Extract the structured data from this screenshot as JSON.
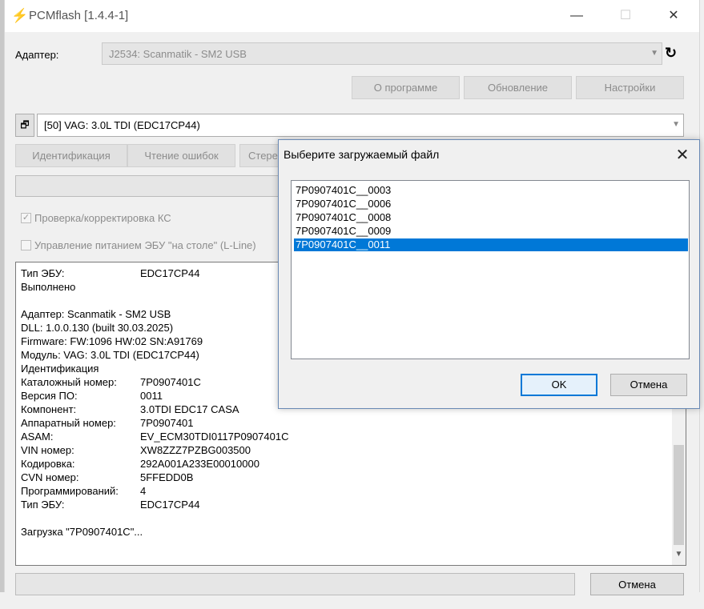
{
  "window": {
    "title": "PCMflash [1.4.4-1]",
    "controls": {
      "minimize": "—",
      "maximize": "☐",
      "close": "✕"
    }
  },
  "adapter": {
    "label": "Адаптер:",
    "value": "J2534: Scanmatik - SM2 USB"
  },
  "top_buttons": {
    "about": "О программе",
    "update": "Обновление",
    "settings": "Настройки"
  },
  "module": {
    "value": "[50] VAG: 3.0L TDI (EDC17CP44)"
  },
  "action_buttons": {
    "identification": "Идентификация",
    "read_errors": "Чтение ошибок",
    "erase_partial": "Стере"
  },
  "options": {
    "checksum": {
      "label": "Проверка/корректировка КС",
      "checked": true
    },
    "power": {
      "label": "Управление питанием ЭБУ \"на столе\" (L-Line)",
      "checked": false
    }
  },
  "log": {
    "head": [
      {
        "key": "Тип ЭБУ:",
        "value": "EDC17CP44"
      },
      {
        "key": "Выполнено",
        "value": ""
      }
    ],
    "info": [
      "Адаптер: Scanmatik - SM2 USB",
      "DLL: 1.0.0.130 (built 30.03.2025)",
      "Firmware: FW:1096 HW:02 SN:A91769",
      "Модуль: VAG: 3.0L TDI (EDC17CP44)",
      "Идентификация"
    ],
    "fields": [
      {
        "key": "Каталожный номер:",
        "value": "7P0907401C"
      },
      {
        "key": "Версия ПО:",
        "value": "0011"
      },
      {
        "key": "Компонент:",
        "value": "3.0TDI EDC17 CASA"
      },
      {
        "key": "Аппаратный номер:",
        "value": "7P0907401"
      },
      {
        "key": "ASAM:",
        "value": "EV_ECM30TDI0117P0907401C"
      },
      {
        "key": "VIN номер:",
        "value": "XW8ZZZ7PZBG003500"
      },
      {
        "key": "Кодировка:",
        "value": "292A001A233E00010000"
      },
      {
        "key": "CVN номер:",
        "value": "5FFEDD0B"
      },
      {
        "key": "Программирований:",
        "value": "4"
      },
      {
        "key": "Тип ЭБУ:",
        "value": "EDC17CP44"
      }
    ],
    "last": "Загрузка \"7P0907401C\"..."
  },
  "bottom": {
    "cancel": "Отмена"
  },
  "dialog": {
    "title": "Выберите загружаемый файл",
    "files": [
      "7P0907401C__0003",
      "7P0907401C__0006",
      "7P0907401C__0008",
      "7P0907401C__0009",
      "7P0907401C__0011"
    ],
    "selected_index": 4,
    "ok": "OK",
    "cancel": "Отмена"
  },
  "colors": {
    "selection": "#0078d7",
    "default_button_border": "#0078d7"
  }
}
